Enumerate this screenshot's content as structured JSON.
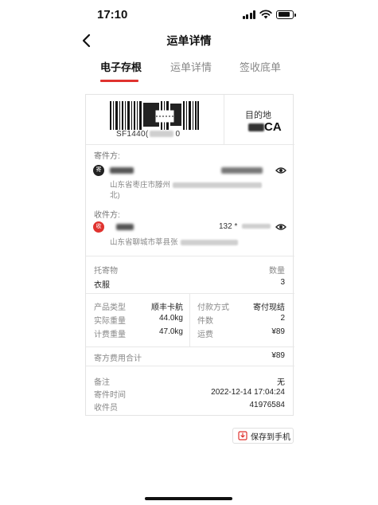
{
  "status": {
    "time": "17:10"
  },
  "nav": {
    "title": "运单详情"
  },
  "tabs": [
    {
      "label": "电子存根",
      "active": true
    },
    {
      "label": "运单详情",
      "active": false
    },
    {
      "label": "签收底单",
      "active": false
    }
  ],
  "waybill": {
    "tracking_visible_prefix": "SF1440(",
    "tracking_visible_suffix": "0",
    "destination_label": "目的地",
    "destination_code_visible": "CA"
  },
  "sender": {
    "section_label": "寄件方:",
    "icon_label": "寄",
    "address_visible_1": "山东省枣庄市滕州",
    "address_visible_2": "北)"
  },
  "receiver": {
    "section_label": "收件方:",
    "icon_label": "收",
    "phone_visible": "132 *",
    "address_visible": "山东省聊城市莘县张"
  },
  "goods": {
    "label": "托寄物",
    "qty_label": "数量",
    "item": "衣服",
    "qty": "3"
  },
  "details": {
    "product_type_label": "产品类型",
    "product_type": "顺丰卡航",
    "actual_weight_label": "实际重量",
    "actual_weight": "44.0kg",
    "billed_weight_label": "计费重量",
    "billed_weight": "47.0kg",
    "payment_label": "付款方式",
    "payment": "寄付现结",
    "pieces_label": "件数",
    "pieces": "2",
    "freight_label": "运费",
    "freight": "¥89"
  },
  "total": {
    "label": "寄方费用合计",
    "value": "¥89"
  },
  "notes": {
    "remark_label": "备注",
    "remark": "无",
    "time_label": "寄件时间",
    "time": "2022-12-14 17:04:24",
    "courier_label": "收件员",
    "courier": "41976584"
  },
  "save_button": {
    "label": "保存到手机"
  },
  "colors": {
    "accent": "#e0332f",
    "sender_icon": "#222222",
    "receiver_icon": "#e0332f"
  }
}
